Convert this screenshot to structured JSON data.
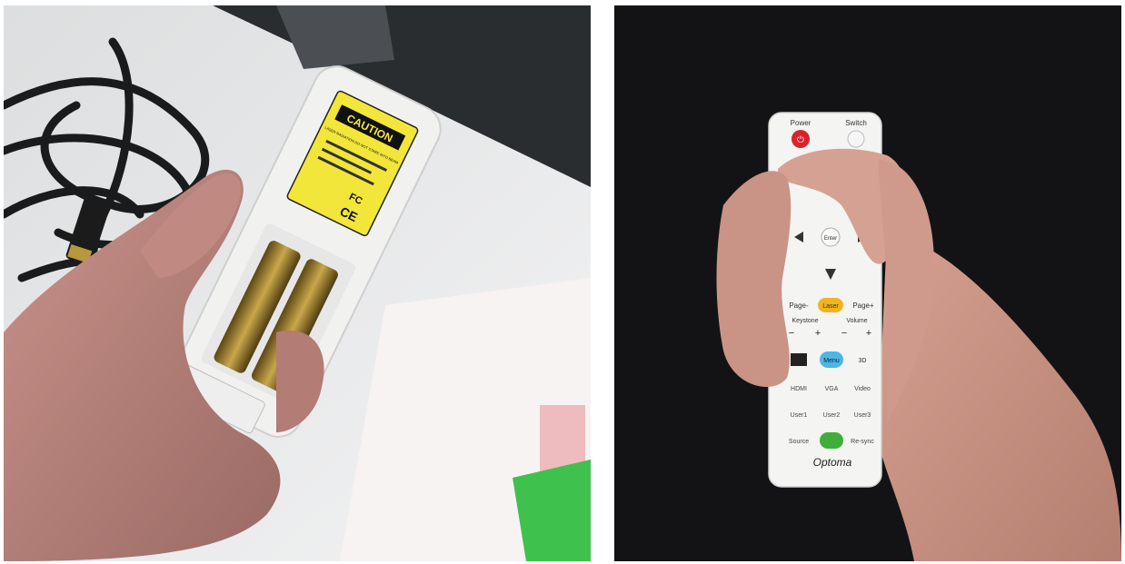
{
  "left_photo": {
    "label": {
      "heading": "CAUTION",
      "warning_text": "LASER RADIATION DO NOT STARE INTO BEAM",
      "marks": [
        "FC",
        "CE"
      ]
    }
  },
  "right_photo": {
    "remote": {
      "brand": "Optoma",
      "top_labels": [
        "Power",
        "Switch"
      ],
      "enter_label": "Enter",
      "row_page": [
        "Page-",
        "Laser",
        "Page+"
      ],
      "row_keystone_volume": [
        "Keystone",
        "Volume"
      ],
      "signs": [
        "−",
        "+",
        "−",
        "+"
      ],
      "row_menu": [
        "",
        "Menu",
        "3D"
      ],
      "row_source_a": [
        "HDMI",
        "VGA",
        "Video"
      ],
      "row_user": [
        "User1",
        "User2",
        "User3"
      ],
      "row_bottom": [
        "Source",
        "",
        "Re-sync"
      ]
    },
    "colors": {
      "power": "#d8242b",
      "laser": "#f2b41e",
      "menu": "#4cb6e6",
      "source_center": "#3fae3b"
    }
  }
}
